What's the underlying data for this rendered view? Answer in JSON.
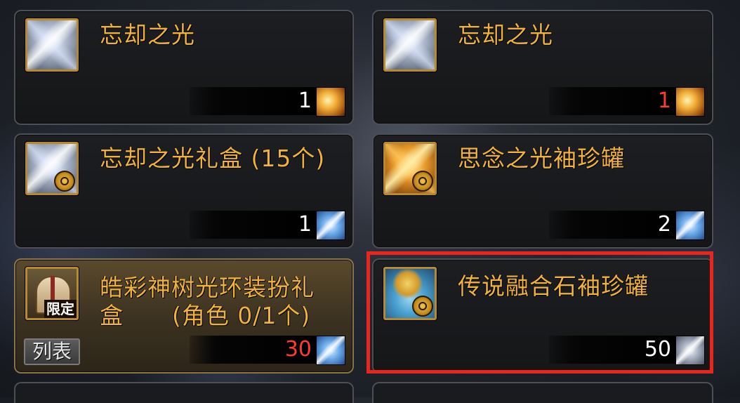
{
  "cards": [
    {
      "title": "忘却之光",
      "title_sub": "",
      "qty": "1",
      "qty_color": "#ffffff",
      "icon": "white-crystal-icon",
      "currency": "gold-coin-icon"
    },
    {
      "title": "忘却之光",
      "title_sub": "",
      "qty": "1",
      "qty_color": "#ff3b2a",
      "icon": "white-crystal-icon",
      "currency": "gold-coin-icon"
    },
    {
      "title": "忘却之光礼盒 (15个)",
      "title_sub": "",
      "qty": "1",
      "qty_color": "#ffffff",
      "icon": "white-crystal-gift-icon",
      "currency": "blue-crystal-icon"
    },
    {
      "title": "思念之光袖珍罐",
      "title_sub": "",
      "qty": "2",
      "qty_color": "#ffffff",
      "icon": "orange-crystal-jar-icon",
      "currency": "blue-crystal-icon"
    },
    {
      "title": "皓彩神树光环装扮礼",
      "title_sub": "盒      (角色 0/1个)",
      "qty": "30",
      "qty_color": "#ff3b2a",
      "icon": "gift-box-icon",
      "badge": "限定",
      "button": "列表",
      "currency": "blue-crystal-icon"
    },
    {
      "title": "传说融合石袖珍罐",
      "title_sub": "",
      "qty": "50",
      "qty_color": "#ffffff",
      "icon": "fusion-stone-jar-icon",
      "currency": "silver-crystal-icon"
    }
  ],
  "highlight_color": "#e8261e"
}
